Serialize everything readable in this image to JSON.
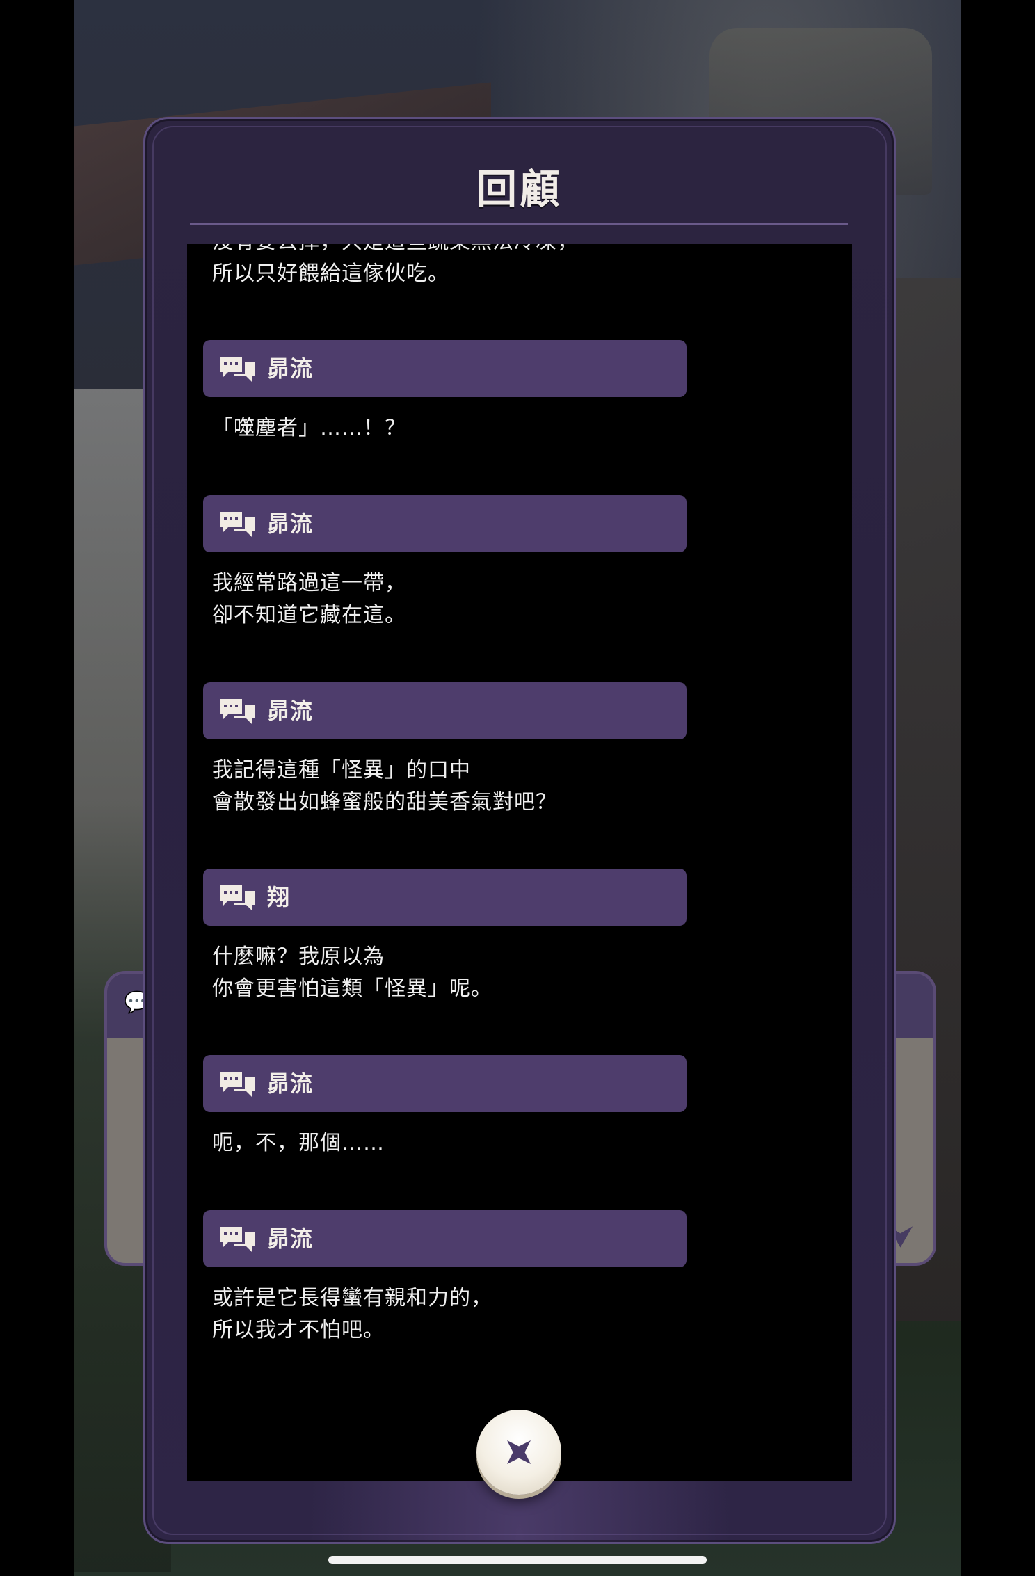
{
  "modal": {
    "title": "回顧",
    "close_icon": "close-x-icon"
  },
  "log": {
    "top_partial_text": "沒有要丟掉，只是這些蔬菜無法冷凍，\n所以只好餵給這傢伙吃。",
    "entries": [
      {
        "speaker": "昴流",
        "text": "「噬塵者」……！？"
      },
      {
        "speaker": "昴流",
        "text": "我經常路過這一帶，\n卻不知道它藏在這。"
      },
      {
        "speaker": "昴流",
        "text": "我記得這種「怪異」的口中\n會散發出如蜂蜜般的甜美香氣對吧？"
      },
      {
        "speaker": "翔",
        "text": "什麼嘛？我原以為\n你會更害怕這類「怪異」呢。"
      },
      {
        "speaker": "昴流",
        "text": "呃，不，那個……"
      },
      {
        "speaker": "昴流",
        "text": "或許是它長得蠻有親和力的，\n所以我才不怕吧。"
      }
    ]
  },
  "icons": {
    "speaker": "speech-bubbles-icon",
    "textbox_chat": "chat-icon",
    "textbox_advance": "chevron-down-icon"
  },
  "colors": {
    "modal_bg": "#2c2440",
    "speaker_bar": "#4e3d6c",
    "log_bg": "#000000",
    "text": "#efefef"
  }
}
